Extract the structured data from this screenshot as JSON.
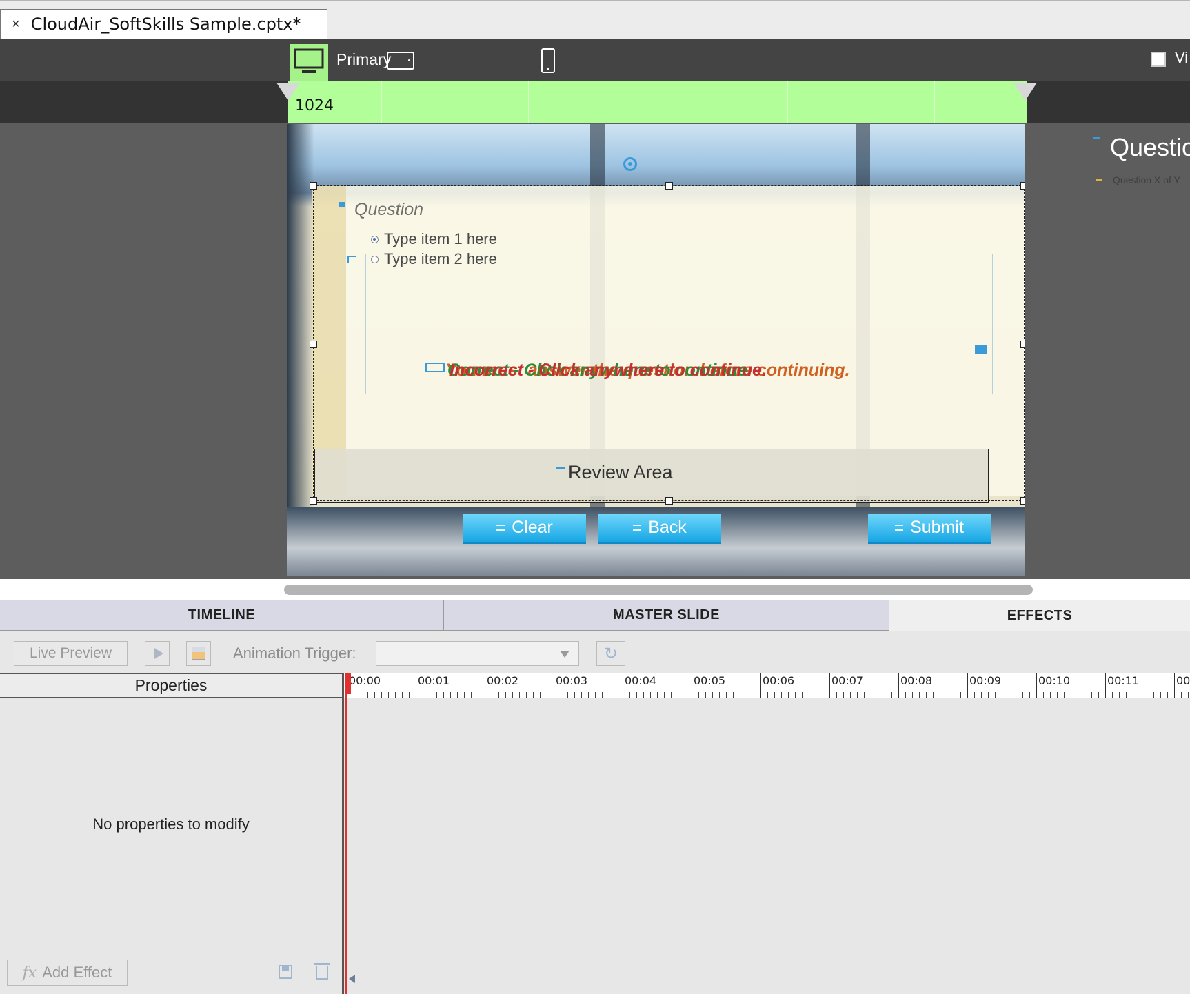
{
  "document_tab": {
    "close_glyph": "×",
    "title": "CloudAir_SoftSkills Sample.cptx*"
  },
  "device_bar": {
    "primary_label": "Primary",
    "breakpoint_value": "1024",
    "view_label": "Vi",
    "icons": [
      "desktop-icon",
      "tablet-icon",
      "phone-icon"
    ],
    "accent_color": "#b2ff99"
  },
  "slide": {
    "question": "Question",
    "answers": [
      {
        "label": "Type item 1 here",
        "selected": true
      },
      {
        "label": "Type item 2 here",
        "selected": false
      }
    ],
    "captions": [
      {
        "text": "Incorrect - Click anywhere to continue.",
        "color": "#c43030"
      },
      {
        "text": "Correct - Click anywhere to continue.",
        "color": "#2e8b3a"
      },
      {
        "text": "You must answer the question before continuing.",
        "color": "#d06020"
      }
    ],
    "review_area": "Review Area",
    "buttons": {
      "clear": "Clear",
      "back": "Back",
      "submit": "Submit"
    }
  },
  "master_preview": {
    "title": "Questio",
    "subtitle": "Question X of Y"
  },
  "panel_tabs": {
    "timeline": "TIMELINE",
    "master_slide": "MASTER SLIDE",
    "effects": "EFFECTS"
  },
  "effects_panel": {
    "live_preview": "Live Preview",
    "animation_trigger_label": "Animation Trigger:",
    "animation_trigger_value": "",
    "properties_header": "Properties",
    "no_properties": "No properties to modify",
    "add_effect": "Add Effect",
    "fx_glyph": "fx",
    "time_ticks": [
      "00:00",
      "00:01",
      "00:02",
      "00:03",
      "00:04",
      "00:05",
      "00:06",
      "00:07",
      "00:08",
      "00:09",
      "00:10",
      "00:11",
      "00"
    ]
  }
}
